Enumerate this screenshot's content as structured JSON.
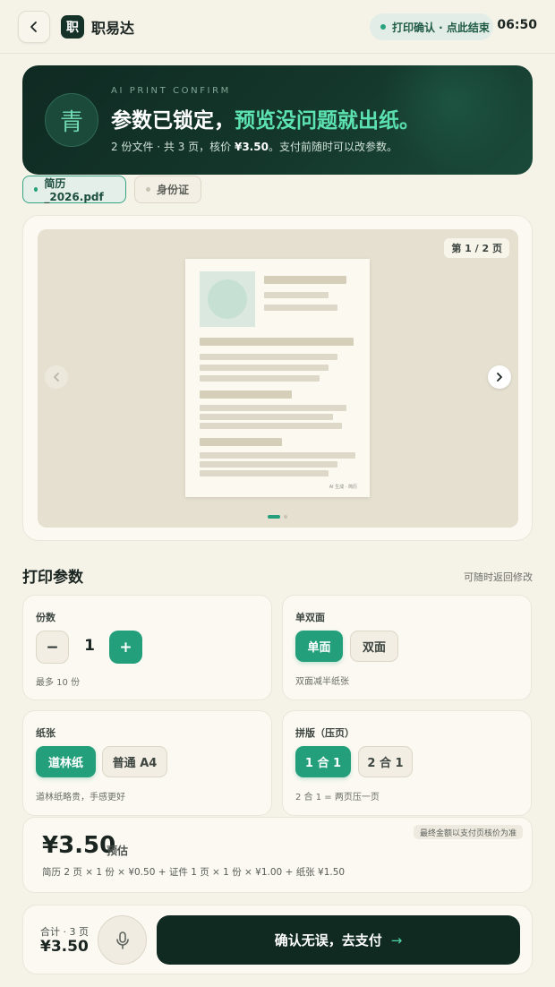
{
  "header": {
    "brand_logo_char": "职",
    "brand_name": "职易达",
    "status_pill": "打印确认 · 点此结束",
    "time": "06:50"
  },
  "hero": {
    "badge_char": "青",
    "eyebrow": "AI PRINT CONFIRM",
    "title_main": "参数已锁定，",
    "title_accent": "预览没问题就出纸。",
    "subtitle_pre": "2 份文件 · 共 3 页，核价 ",
    "subtitle_price": "¥3.50",
    "subtitle_post": "。支付前随时可以改参数。"
  },
  "files": [
    {
      "label": "简历_2026.pdf",
      "active": true
    },
    {
      "label": "身份证",
      "active": false
    }
  ],
  "preview": {
    "page_indicator": "第 1 / 2 页",
    "doc_footer": "AI 生成 · 简历"
  },
  "params": {
    "section_title": "打印参数",
    "section_hint": "可随时返回修改",
    "copies": {
      "label": "份数",
      "value": "1",
      "minus": "−",
      "plus": "+",
      "note": "最多 10 份"
    },
    "duplex": {
      "label": "单双面",
      "options": [
        "单面",
        "双面"
      ],
      "selected": "单面",
      "note": "双面减半纸张"
    },
    "paper": {
      "label": "纸张",
      "options": [
        "道林纸",
        "普通 A4"
      ],
      "selected": "道林纸",
      "note": "道林纸略贵，手感更好"
    },
    "layout": {
      "label": "拼版（压页）",
      "options": [
        "1 合 1",
        "2 合 1"
      ],
      "selected": "1 合 1",
      "note": "2 合 1 = 两页压一页"
    }
  },
  "price": {
    "amount": "¥3.50",
    "estimate_label": "预估",
    "breakdown": "简历 2 页 × 1 份 × ¥0.50 + 证件 1 页 × 1 份 × ¥1.00 + 纸张 ¥1.50",
    "disclaimer": "最终金额以支付页核价为准"
  },
  "footer": {
    "total_label": "合计 · 3 页",
    "total_value": "¥3.50",
    "pay_label": "确认无误，去支付",
    "pay_arrow": "→",
    "mic_icon": "microphone-icon"
  },
  "colors": {
    "accent": "#23a07b",
    "dark": "#102a22",
    "background": "#f5f2e8"
  }
}
